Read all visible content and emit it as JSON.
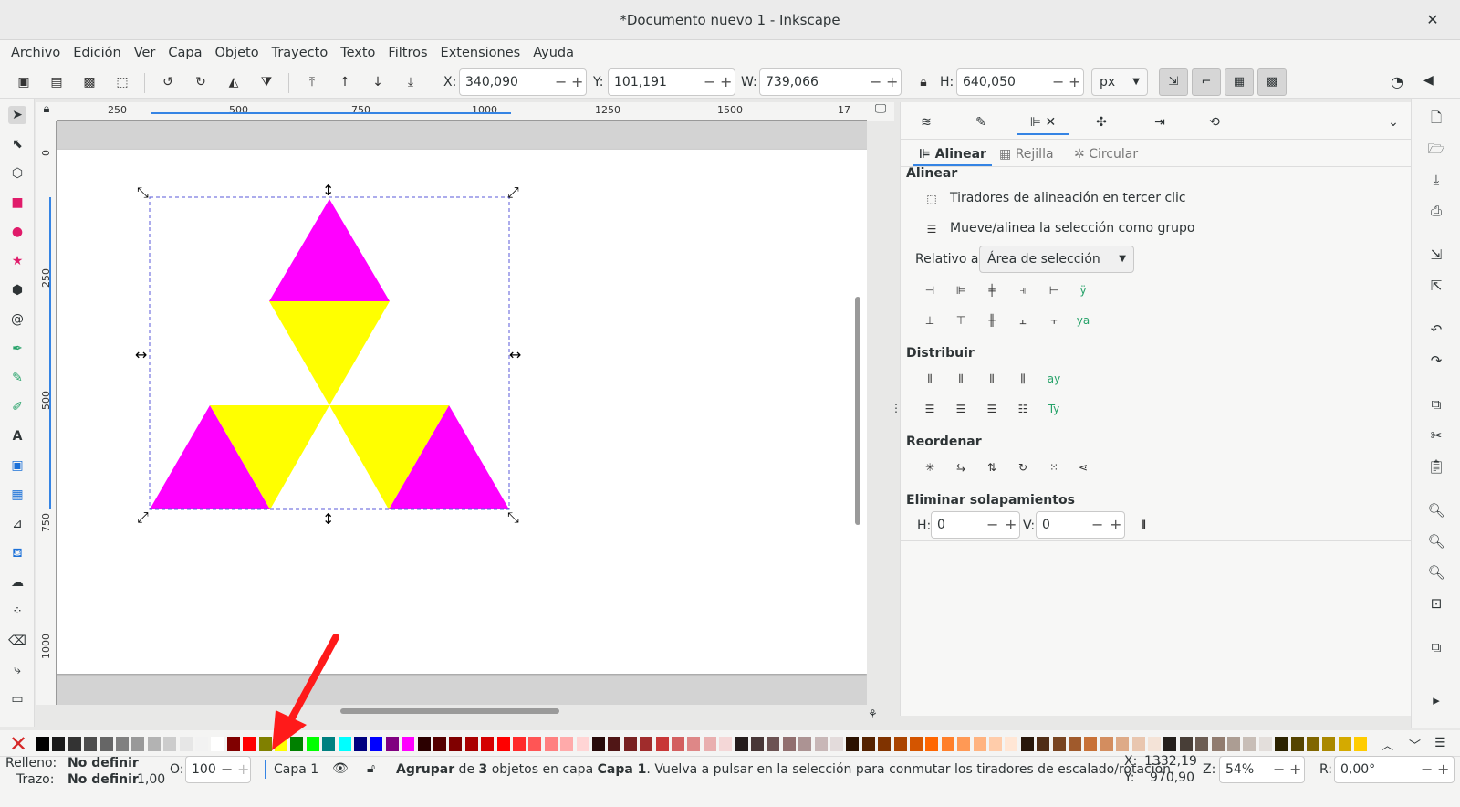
{
  "window": {
    "title": "*Documento nuevo 1 - Inkscape",
    "close": "✕"
  },
  "menu": [
    "Archivo",
    "Edición",
    "Ver",
    "Capa",
    "Objeto",
    "Trayecto",
    "Texto",
    "Filtros",
    "Extensiones",
    "Ayuda"
  ],
  "toolbar": {
    "x_label": "X:",
    "x_value": "340,090",
    "y_label": "Y:",
    "y_value": "101,191",
    "w_label": "W:",
    "w_value": "739,066",
    "h_label": "H:",
    "h_value": "640,050",
    "unit": "px",
    "minus": "−",
    "plus": "+"
  },
  "rulers": {
    "h_ticks": [
      "250",
      "500",
      "750",
      "1000",
      "1250",
      "1500",
      "17"
    ],
    "v_ticks": [
      "0",
      "250",
      "500",
      "750",
      "1000"
    ]
  },
  "panel": {
    "tabs": [
      "Alinear",
      "Rejilla",
      "Circular"
    ],
    "align_title": "Alinear",
    "opt1": "Tiradores de alineación en tercer clic",
    "opt2": "Mueve/alinea la selección como grupo",
    "relative_label": "Relativo a:",
    "relative_value": "Área de selección",
    "distribute_title": "Distribuir",
    "reorder_title": "Reordenar",
    "overlap_title": "Eliminar solapamientos",
    "h_label": "H:",
    "h_value": "0",
    "v_label": "V:",
    "v_value": "0"
  },
  "status": {
    "fill_label": "Relleno:",
    "fill_value": "No definir",
    "stroke_label": "Trazo:",
    "stroke_value": "No definir",
    "stroke_width": "1,00",
    "opacity_label": "O:",
    "opacity_value": "100",
    "layer": "Capa 1",
    "msg_group": "Agrupar",
    "msg_de": " de ",
    "msg_count": "3",
    "msg_objs": " objetos en capa ",
    "msg_layer": "Capa 1",
    "msg_rest": ". Vuelva a pulsar en la selección para conmutar los tiradores de escalado/rotación.",
    "cx_label": "X:",
    "cx_value": "1332,19",
    "cy_label": "Y:",
    "cy_value": "970,90",
    "zoom_label": "Z:",
    "zoom_value": "54%",
    "rot_label": "R:",
    "rot_value": "0,00°"
  },
  "colors": {
    "magenta": "#ff00ff",
    "yellow": "#ffff00",
    "accent": "#3584e4",
    "arrow": "#ff1a1a"
  },
  "palette": [
    "#000000",
    "#1a1a1a",
    "#333333",
    "#4d4d4d",
    "#666666",
    "#808080",
    "#999999",
    "#b3b3b3",
    "#cccccc",
    "#e6e6e6",
    "#f2f2f2",
    "#ffffff",
    "#800000",
    "#ff0000",
    "#808000",
    "#ffff00",
    "#008000",
    "#00ff00",
    "#008080",
    "#00ffff",
    "#000080",
    "#0000ff",
    "#800080",
    "#ff00ff",
    "#2b0000",
    "#550000",
    "#800000",
    "#aa0000",
    "#d40000",
    "#ff0000",
    "#ff2a2a",
    "#ff5555",
    "#ff8080",
    "#ffaaaa",
    "#ffd5d5",
    "#280b0b",
    "#501616",
    "#782121",
    "#a02c2c",
    "#c83737",
    "#d35f5f",
    "#de8787",
    "#e9afaf",
    "#f4d7d7",
    "#241c1c",
    "#483737",
    "#6c5353",
    "#916f6f",
    "#ac9393",
    "#c8b7b7",
    "#e3dbdb",
    "#2b1100",
    "#552200",
    "#803300",
    "#aa4400",
    "#d45500",
    "#ff6600",
    "#ff7f2a",
    "#ff9955",
    "#ffb380",
    "#ffccaa",
    "#ffe6d5",
    "#28170b",
    "#502d16",
    "#784421",
    "#a05a2c",
    "#c87137",
    "#d38d5f",
    "#deaa87",
    "#e9c6af",
    "#f4e3d7",
    "#241f1c",
    "#483e37",
    "#6c5d53",
    "#917c6f",
    "#ac9d93",
    "#c8beb7",
    "#e3dedb",
    "#2b2200",
    "#554400",
    "#806600",
    "#aa8800",
    "#d4aa00",
    "#ffcc00"
  ]
}
